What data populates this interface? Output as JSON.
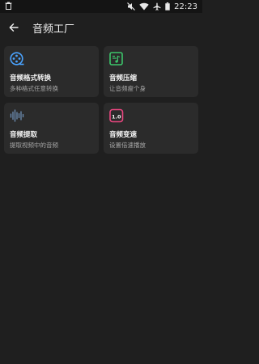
{
  "status_bar": {
    "time": "22:23",
    "icons": [
      "trash-icon",
      "mute-icon",
      "wifi-icon",
      "airplane-icon",
      "battery-icon"
    ]
  },
  "app_bar": {
    "title": "音频工厂",
    "back_icon": "arrow-left-icon"
  },
  "tools": [
    {
      "title": "音频格式转换",
      "subtitle": "多种格式任意转换",
      "icon": "film-reel-icon",
      "color": "#4aa3ff"
    },
    {
      "title": "音频压缩",
      "subtitle": "让音频瘦个身",
      "icon": "compress-icon",
      "color": "#3cc46a"
    },
    {
      "title": "音频提取",
      "subtitle": "提取视频中的音频",
      "icon": "waveform-icon",
      "color": "#6e8fb5"
    },
    {
      "title": "音频变速",
      "subtitle": "设置倍速播放",
      "icon": "speed-badge-icon",
      "color": "#e8467f",
      "badge": "1.0"
    }
  ]
}
